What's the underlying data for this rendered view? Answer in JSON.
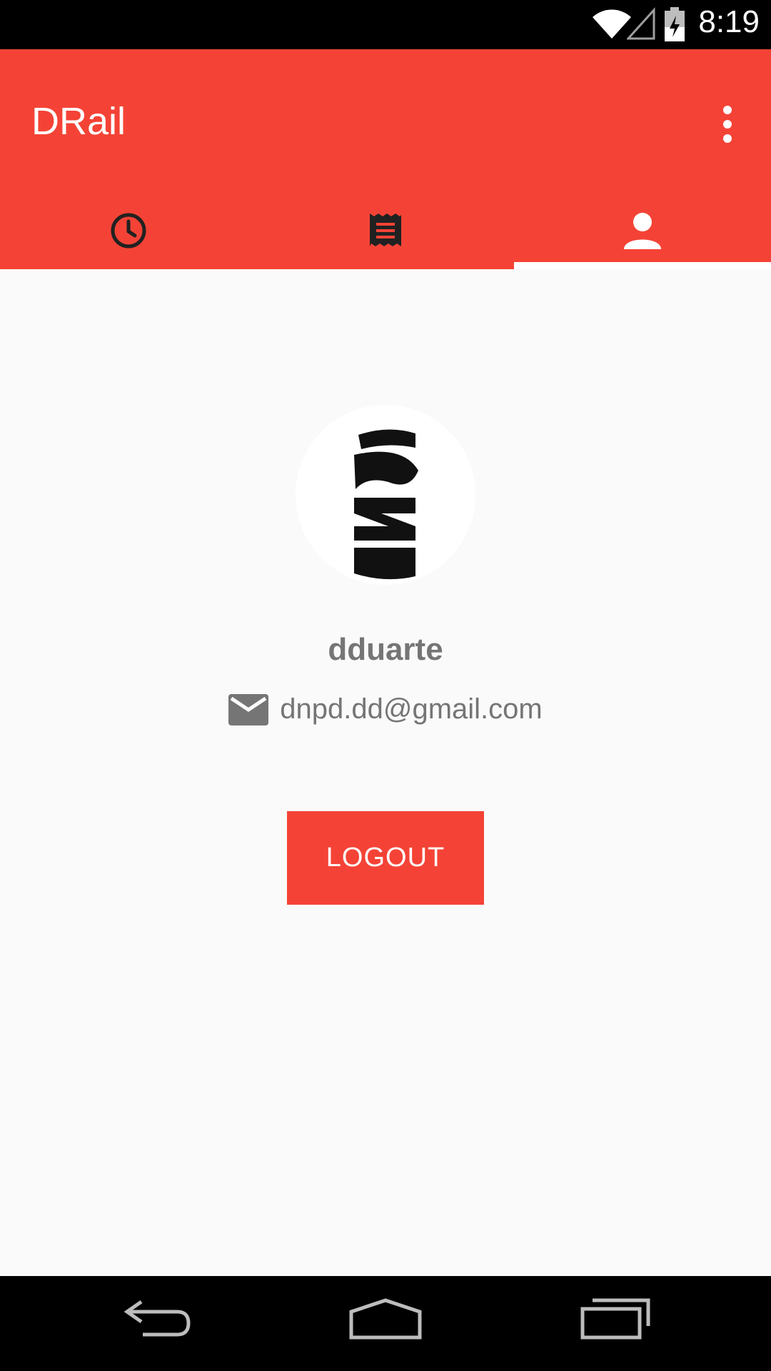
{
  "status_bar": {
    "time": "8:19",
    "icons": [
      "wifi-icon",
      "cell-signal-icon",
      "battery-icon"
    ]
  },
  "app_bar": {
    "title": "DRail",
    "menu_icon": "more-vert-icon",
    "color": "#f44336"
  },
  "tabs": [
    {
      "icon": "clock-icon",
      "active": false
    },
    {
      "icon": "receipt-icon",
      "active": false
    },
    {
      "icon": "person-icon",
      "active": true
    }
  ],
  "profile": {
    "username": "dduarte",
    "email": "dnpd.dd@gmail.com",
    "email_icon": "mail-icon"
  },
  "actions": {
    "logout_label": "LOGOUT"
  },
  "nav_bar": {
    "icons": [
      "back-icon",
      "home-icon",
      "recents-icon"
    ]
  }
}
